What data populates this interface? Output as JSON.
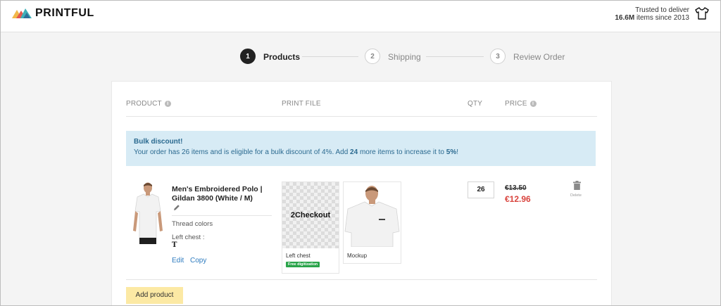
{
  "brand": {
    "name": "PRINTFUL"
  },
  "trust": {
    "line1": "Trusted to deliver",
    "count": "16.6M",
    "line2_rest": " items since 2013"
  },
  "steps": [
    {
      "num": "1",
      "label": "Products",
      "state": "active"
    },
    {
      "num": "2",
      "label": "Shipping",
      "state": "todo"
    },
    {
      "num": "3",
      "label": "Review Order",
      "state": "todo"
    }
  ],
  "table": {
    "headers": {
      "product": "PRODUCT",
      "print_file": "PRINT FILE",
      "qty": "QTY",
      "price": "PRICE"
    }
  },
  "bulk_discount": {
    "title": "Bulk discount!",
    "text_part1": "Your order has 26 items and is eligible for a bulk discount of 4%. Add ",
    "items_needed": "24",
    "text_part2": " more items to increase it to ",
    "target_percent": "5%",
    "text_part3": "!"
  },
  "item": {
    "name": "Men's Embroidered Polo | Gildan 3800 (White / M)",
    "thread_colors_label": "Thread colors",
    "placement_label": "Left chest :",
    "thread_symbol": "T",
    "edit_label": "Edit",
    "copy_label": "Copy",
    "print_file": {
      "image_text": "2Checkout",
      "caption": "Left chest",
      "badge": "Free digitization"
    },
    "mockup": {
      "caption": "Mockup"
    },
    "qty": "26",
    "old_price": "€13.50",
    "new_price": "€12.96",
    "delete_label": "Delete"
  },
  "add_product_label": "Add product",
  "colors": {
    "accent_blue": "#2d7bbf",
    "sale_red": "#d9443e",
    "alert_bg": "#d7ebf5",
    "add_button_bg": "#fce9a4",
    "badge_green": "#2aa44a"
  }
}
